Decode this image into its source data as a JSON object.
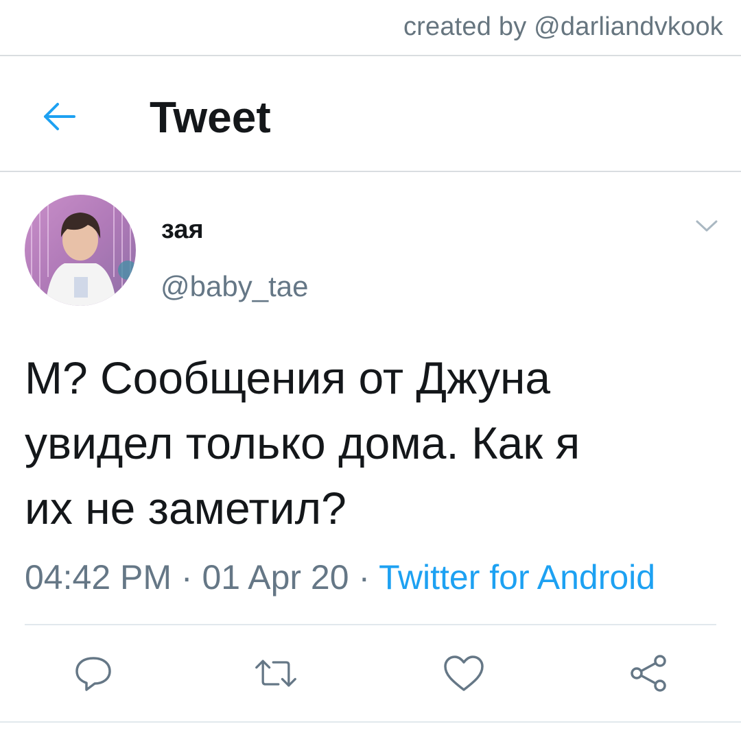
{
  "watermark": "created by @darliandvkook",
  "header": {
    "title": "Tweet"
  },
  "tweet": {
    "author": {
      "display_name": "зая",
      "handle": "@baby_tae"
    },
    "text_lines": [
      "М? Сообщения от Джуна",
      "увидел только дома. Как я",
      "их не заметил?"
    ],
    "meta": {
      "time": "04:42 PM",
      "separator": "·",
      "date": "01 Apr 20",
      "source": "Twitter for Android"
    }
  },
  "colors": {
    "accent": "#1da1f2",
    "text_primary": "#14171a",
    "text_secondary": "#657786",
    "divider": "#e1e8ed"
  },
  "icons": {
    "back": "arrow-left-icon",
    "caret": "chevron-down-icon",
    "reply": "reply-icon",
    "retweet": "retweet-icon",
    "like": "heart-icon",
    "share": "share-icon"
  }
}
